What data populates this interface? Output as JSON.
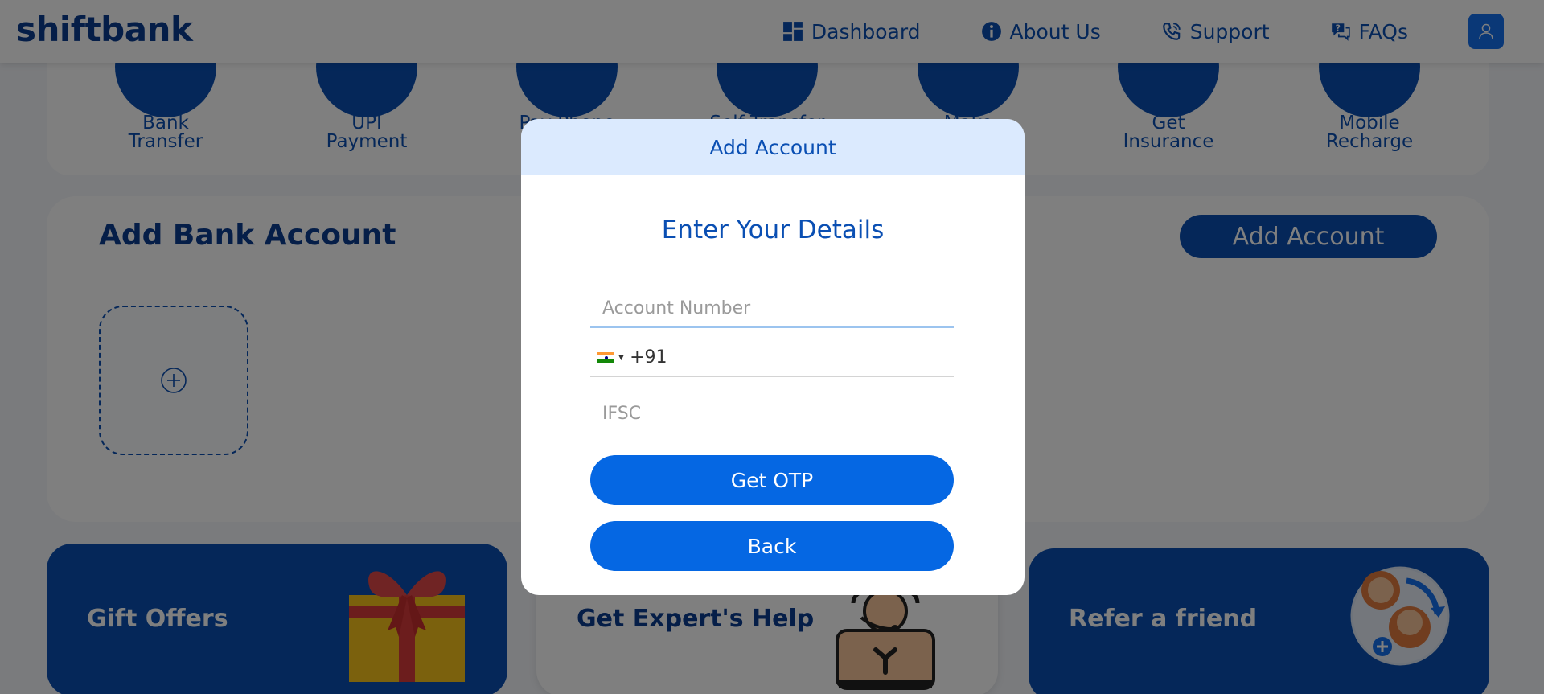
{
  "header": {
    "logo": "shiftbank",
    "nav": [
      {
        "label": "Dashboard",
        "icon": "dashboard-icon"
      },
      {
        "label": "About Us",
        "icon": "info-icon"
      },
      {
        "label": "Support",
        "icon": "phone-icon"
      },
      {
        "label": "FAQs",
        "icon": "faq-icon"
      }
    ],
    "avatar_icon": "user-icon"
  },
  "quick_actions": [
    {
      "label": "Bank\nTransfer"
    },
    {
      "label": "UPI\nPayment"
    },
    {
      "label": "Pay Phone"
    },
    {
      "label": "Self Transfer"
    },
    {
      "label": "Make"
    },
    {
      "label": "Get\nInsurance"
    },
    {
      "label": "Mobile\nRecharge"
    }
  ],
  "bank_section": {
    "title": "Add Bank Account",
    "add_button": "Add Account",
    "add_tile_icon": "plus-circle-icon"
  },
  "promos": {
    "gift": {
      "label": "Gift Offers",
      "icon": "gift-icon"
    },
    "expert": {
      "label": "Get Expert's Help",
      "icon": "support-agent-icon"
    },
    "refer": {
      "label": "Refer a friend",
      "icon": "refer-friend-icon"
    }
  },
  "modal": {
    "header": "Add Account",
    "subtitle": "Enter Your Details",
    "account_placeholder": "Account Number",
    "phone_code": "+91",
    "phone_country": "India",
    "ifsc_placeholder": "IFSC",
    "otp_button": "Get OTP",
    "back_button": "Back"
  },
  "colors": {
    "primary": "#0a4fb3",
    "button": "#0567e3",
    "modal_header_bg": "#dbeafe",
    "overlay": "rgba(0,0,0,0.5)"
  }
}
